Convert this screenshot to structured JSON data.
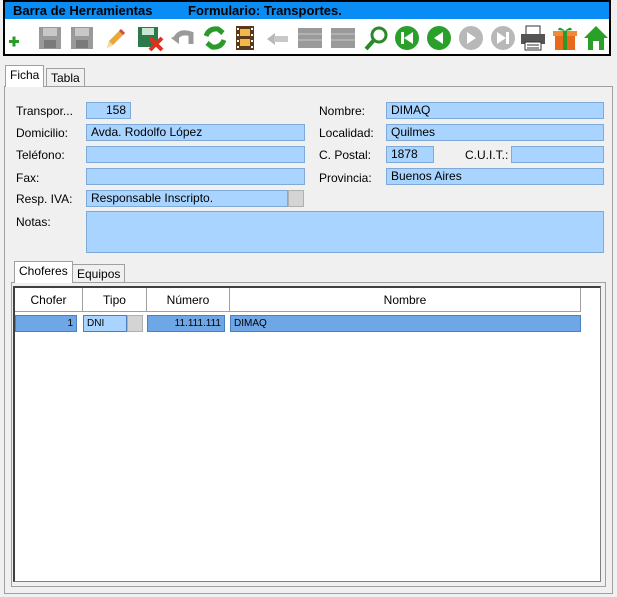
{
  "window": {
    "toolbar_title": "Barra de Herramientas",
    "form_title": "Formulario: Transportes."
  },
  "toolbar_icons": [
    "add-icon",
    "save-icon",
    "save-as-icon",
    "edit-icon",
    "delete-icon",
    "undo-icon",
    "refresh-icon",
    "film-icon",
    "back-arrow-icon",
    "grid-icon",
    "grid2-icon",
    "search-icon",
    "first-icon",
    "prev-icon",
    "next-icon",
    "last-icon",
    "print-icon",
    "gift-icon",
    "home-icon"
  ],
  "tabs": {
    "ficha": "Ficha",
    "tabla": "Tabla"
  },
  "form": {
    "transporte_label": "Transpor...",
    "transporte_value": "158",
    "nombre_label": "Nombre:",
    "nombre_value": "DIMAQ",
    "domicilio_label": "Domicilio:",
    "domicilio_value": "Avda. Rodolfo López",
    "localidad_label": "Localidad:",
    "localidad_value": "Quilmes",
    "telefono_label": "Teléfono:",
    "telefono_value": "",
    "cpostal_label": "C. Postal:",
    "cpostal_value": "1878",
    "cuit_label": "C.U.I.T.:",
    "cuit_value": "",
    "fax_label": "Fax:",
    "fax_value": "",
    "provincia_label": "Provincia:",
    "provincia_value": "Buenos Aires",
    "iva_label": "Resp. IVA:",
    "iva_value": "Responsable Inscripto.",
    "notas_label": "Notas:",
    "notas_value": ""
  },
  "subtabs": {
    "choferes": "Choferes",
    "equipos": "Equipos"
  },
  "grid": {
    "headers": {
      "chofer": "Chofer",
      "tipo": "Tipo",
      "numero": "Número",
      "nombre": "Nombre"
    },
    "row": {
      "chofer": "1",
      "tipo": "DNI",
      "numero": "11.111.111",
      "nombre": "DIMAQ"
    }
  },
  "colors": {
    "title_bar": "#0a8cf5",
    "field_bg": "#a8d4ff",
    "selected_row": "#6fa6e6"
  }
}
